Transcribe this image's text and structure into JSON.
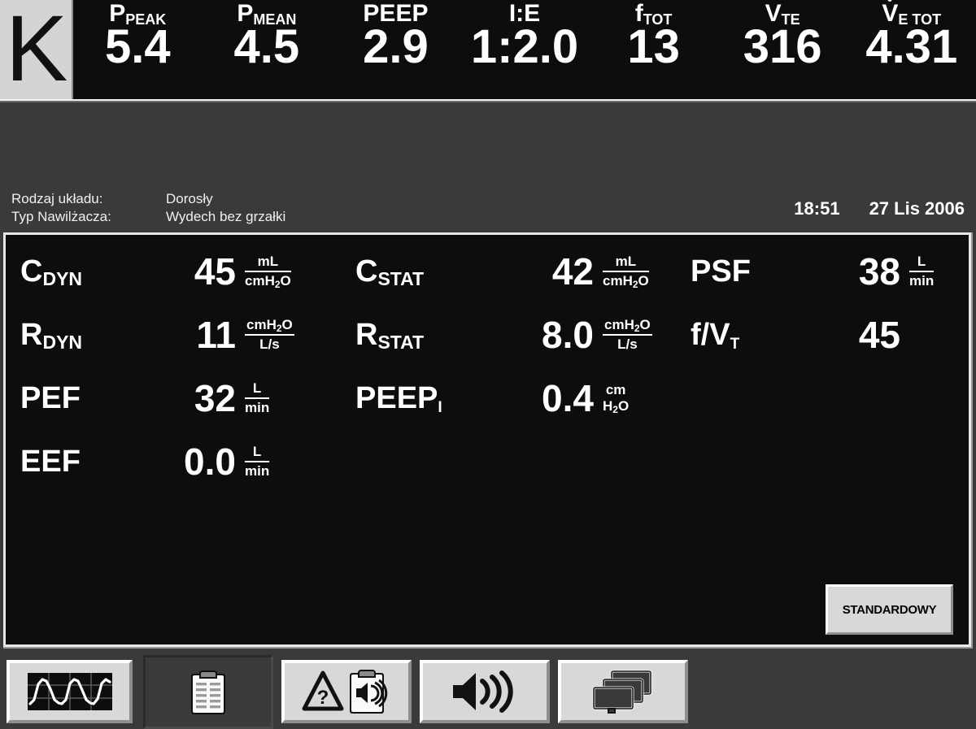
{
  "device": {
    "brand_letter": "K"
  },
  "header": {
    "metrics": [
      {
        "label_main": "P",
        "label_sub": "PEAK",
        "value": "5.4",
        "name": "p-peak"
      },
      {
        "label_main": "P",
        "label_sub": "MEAN",
        "value": "4.5",
        "name": "p-mean"
      },
      {
        "label_main": "PEEP",
        "label_sub": "",
        "value": "2.9",
        "name": "peep"
      },
      {
        "label_main": "I:E",
        "label_sub": "",
        "value": "1:2.0",
        "name": "ie-ratio"
      },
      {
        "label_main": "f",
        "label_sub": "TOT",
        "value": "13",
        "name": "f-tot"
      },
      {
        "label_main": "V",
        "label_sub": "TE",
        "value": "316",
        "name": "vte"
      },
      {
        "label_main": "V",
        "label_sub": "E TOT",
        "value": "4.31",
        "name": "ve-tot",
        "dot": true
      }
    ]
  },
  "info": {
    "rows": [
      {
        "key": "Rodzaj układu:",
        "value": "Dorosły"
      },
      {
        "key": "Typ Nawilżacza:",
        "value": "Wydech bez grzałki"
      }
    ],
    "time": "18:51",
    "date": "27 Lis 2006"
  },
  "main": {
    "columns": [
      {
        "name": "column-1",
        "rows": [
          {
            "label": "C",
            "sub": "DYN",
            "value": "45",
            "unit_num": "mL",
            "unit_den": "cmH2O",
            "unit_style": "frac"
          },
          {
            "label": "R",
            "sub": "DYN",
            "value": "11",
            "unit_num": "cmH2O",
            "unit_den": "L/s",
            "unit_style": "frac"
          },
          {
            "label": "PEF",
            "sub": "",
            "value": "32",
            "unit_num": "L",
            "unit_den": "min",
            "unit_style": "frac"
          },
          {
            "label": "EEF",
            "sub": "",
            "value": "0.0",
            "unit_num": "L",
            "unit_den": "min",
            "unit_style": "frac"
          }
        ]
      },
      {
        "name": "column-2",
        "rows": [
          {
            "label": "C",
            "sub": "STAT",
            "value": "42",
            "unit_num": "mL",
            "unit_den": "cmH2O",
            "unit_style": "frac"
          },
          {
            "label": "R",
            "sub": "STAT",
            "value": "8.0",
            "unit_num": "cmH2O",
            "unit_den": "L/s",
            "unit_style": "frac"
          },
          {
            "label": "PEEP",
            "sub": "I",
            "value": "0.4",
            "unit_num": "cm",
            "unit_den": "H2O",
            "unit_style": "stack"
          }
        ]
      },
      {
        "name": "column-3",
        "rows": [
          {
            "label": "PSF",
            "sub": "",
            "value": "38",
            "unit_num": "L",
            "unit_den": "min",
            "unit_style": "frac"
          },
          {
            "label": "f/V",
            "sub": "T",
            "value": "45",
            "unit_num": "",
            "unit_den": "",
            "unit_style": "none"
          }
        ]
      }
    ],
    "standard_button_label": "STANDARDOWY"
  },
  "toolbar": {
    "buttons": [
      {
        "name": "tab-waveforms",
        "icon": "waveform-icon",
        "active": false
      },
      {
        "name": "tab-clipboard-data",
        "icon": "clipboard-icon",
        "active": true
      },
      {
        "name": "tab-alarm-log",
        "icon": "alarm-clipboard-icon",
        "active": false
      },
      {
        "name": "tab-audio-pause",
        "icon": "speaker-icon",
        "active": false
      },
      {
        "name": "tab-screens",
        "icon": "stacked-screens-icon",
        "active": false
      }
    ]
  },
  "colors": {
    "panel_dark": "#3a3a3a",
    "screen_black": "#0d0d0d",
    "button_face": "#d8d8d8",
    "text_white": "#ffffff"
  }
}
